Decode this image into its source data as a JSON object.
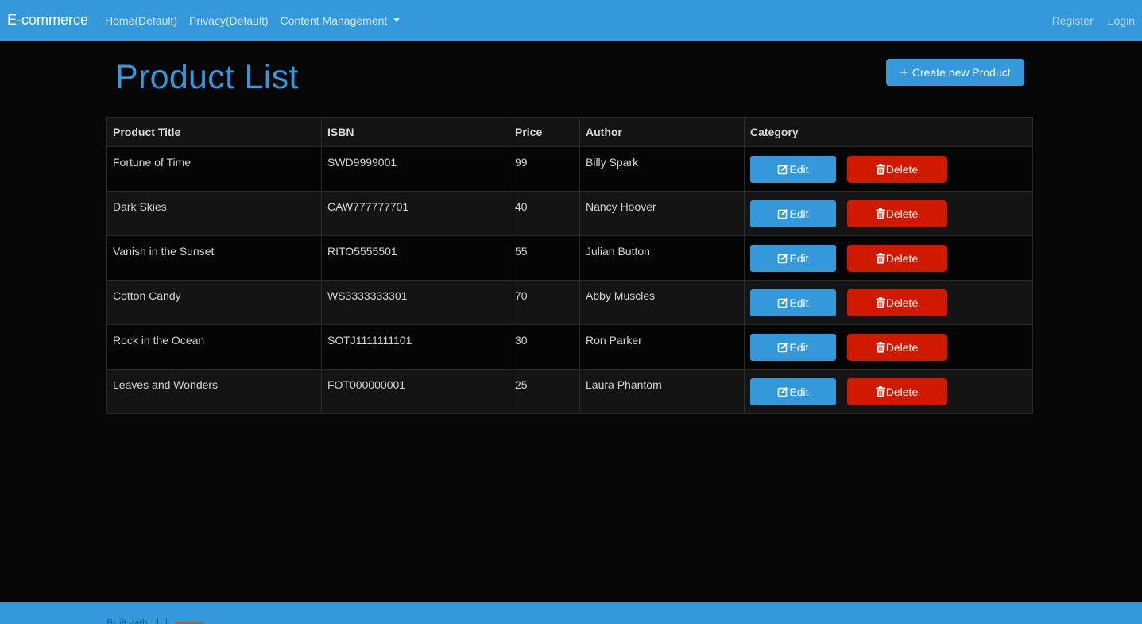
{
  "nav": {
    "brand": "E-commerce",
    "links": [
      "Home(Default)",
      "Privacy(Default)",
      "Content Management"
    ],
    "right_links": [
      "Register",
      "Login"
    ]
  },
  "page": {
    "title": "Product List",
    "create_button": "Create new Product"
  },
  "table": {
    "headers": [
      "Product Title",
      "ISBN",
      "Price",
      "Author",
      "Category"
    ],
    "rows": [
      {
        "title": "Fortune of Time",
        "isbn": "SWD9999001",
        "price": "99",
        "author": "Billy Spark"
      },
      {
        "title": "Dark Skies",
        "isbn": "CAW777777701",
        "price": "40",
        "author": "Nancy Hoover"
      },
      {
        "title": "Vanish in the Sunset",
        "isbn": "RITO5555501",
        "price": "55",
        "author": "Julian Button"
      },
      {
        "title": "Cotton Candy",
        "isbn": "WS3333333301",
        "price": "70",
        "author": "Abby Muscles"
      },
      {
        "title": "Rock in the Ocean",
        "isbn": "SOTJ1111111101",
        "price": "30",
        "author": "Ron Parker"
      },
      {
        "title": "Leaves and Wonders",
        "isbn": "FOT000000001",
        "price": "25",
        "author": "Laura Phantom"
      }
    ],
    "edit_label": "Edit",
    "delete_label": "Delete"
  },
  "footer": {
    "text": "Built with"
  },
  "colors": {
    "primary": "#3498db",
    "danger": "#d01a00",
    "background": "#060606"
  },
  "icons": {
    "edit": "edit-icon",
    "delete": "trash-icon",
    "create": "plus-icon",
    "dropdown": "chevron-down-icon"
  }
}
